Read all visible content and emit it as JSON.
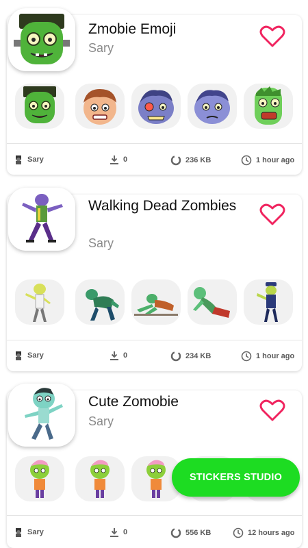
{
  "packs": [
    {
      "title": "Zmobie Emoji",
      "author": "Sary",
      "downloads": "0",
      "size": "236 KB",
      "updated": "1 hour ago",
      "stickers": [
        "frankenstein-face",
        "boy-face",
        "blue-zombie-face",
        "purple-zombie-face",
        "green-zombie-face"
      ]
    },
    {
      "title": "Walking Dead Zombies",
      "author": "Sary",
      "downloads": "0",
      "size": "234 KB",
      "updated": "1 hour ago",
      "stickers": [
        "yellow-zombie",
        "crouching-zombie",
        "crawling-zombie",
        "lying-zombie",
        "policeman-zombie"
      ]
    },
    {
      "title": "Cute Zomobie",
      "author": "Sary",
      "downloads": "0",
      "size": "556 KB",
      "updated": "12 hours ago",
      "stickers": [
        "brain-zombie",
        "brain-zombie",
        "brain-zombie",
        "brain-zombie",
        "brain-zombie"
      ]
    }
  ],
  "fab_label": "STICKERS STUDIO",
  "colors": {
    "heart": "#f0245f",
    "fab": "#1ddc22",
    "zombie_green": "#6fbd3b"
  },
  "icons": [
    "author-icon",
    "download-icon",
    "size-icon",
    "clock-icon",
    "heart-icon"
  ]
}
